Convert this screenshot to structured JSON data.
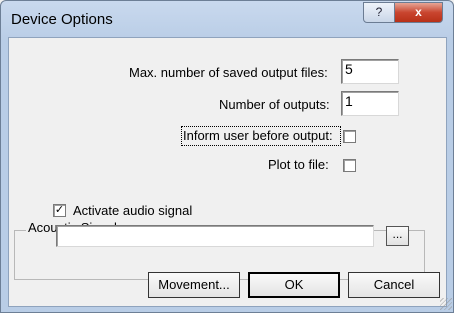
{
  "window": {
    "title": "Device Options",
    "help_glyph": "?",
    "close_glyph": "x"
  },
  "fields": {
    "max_saved_files_label": "Max. number of saved output files:",
    "max_saved_files_value": "5",
    "num_outputs_label": "Number of outputs:",
    "num_outputs_value": "1",
    "inform_user_label": "Inform user before output:",
    "inform_user_checked": false,
    "plot_to_file_label": "Plot to file:",
    "plot_to_file_checked": false
  },
  "acoustic": {
    "group_label": "Acoustic Signal:",
    "activate_label": "Activate audio signal",
    "activate_checked": true,
    "path_value": "",
    "browse_label": "..."
  },
  "buttons": {
    "movement": "Movement...",
    "ok": "OK",
    "cancel": "Cancel"
  }
}
